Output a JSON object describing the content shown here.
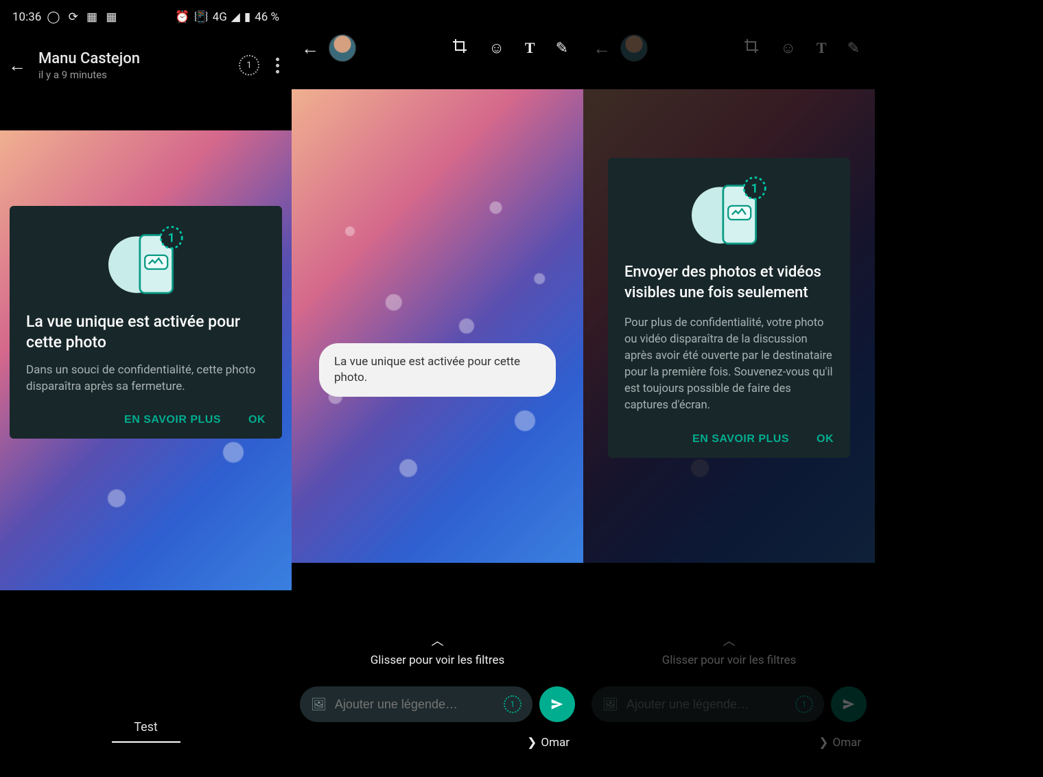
{
  "statusbar": {
    "time": "10:36",
    "net": "4G",
    "battery": "46 %"
  },
  "panel1": {
    "contact_name": "Manu Castejon",
    "subtitle": "il y a 9 minutes",
    "card_title": "La vue unique est activée pour cette photo",
    "card_body": "Dans un souci de confidentialité, cette photo disparaîtra après sa fermeture.",
    "learn_more": "EN SAVOIR PLUS",
    "ok": "OK",
    "bottom_label": "Test"
  },
  "panel2": {
    "toast": "La vue unique est activée pour cette photo.",
    "filters_hint": "Glisser pour voir les filtres",
    "caption_placeholder": "Ajouter une légende…",
    "recipient": "Omar"
  },
  "panel3": {
    "card_title": "Envoyer des photos et vidéos visibles une fois seulement",
    "card_body": "Pour plus de confidentialité, votre photo ou vidéo disparaîtra de la discussion après avoir été ouverte par le destinataire pour la première fois. Souvenez-vous qu'il est toujours possible de faire des captures d'écran.",
    "learn_more": "EN SAVOIR PLUS",
    "ok": "OK",
    "filters_hint": "Glisser pour voir les filtres",
    "caption_placeholder": "Ajouter une légende…",
    "recipient": "Omar"
  },
  "colors": {
    "accent": "#00ad8f",
    "card_bg": "#18272a"
  }
}
